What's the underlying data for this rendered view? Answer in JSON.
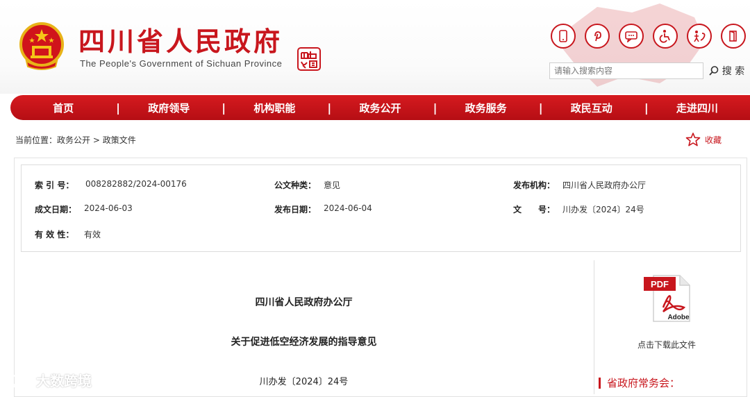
{
  "header": {
    "title": "四川省人民政府",
    "subtitle": "The People's Government of Sichuan Province",
    "emblem_icon": "national-emblem-icon",
    "seal_icon": "sichuan-seal-icon",
    "accent_color": "#c8161d",
    "icons": [
      "phone-icon",
      "pinterest-icon",
      "chat-icon",
      "accessibility-icon",
      "elder-care-icon",
      "exit-icon"
    ]
  },
  "search": {
    "placeholder": "请输入搜索内容",
    "button_label": "搜 索"
  },
  "nav": {
    "items": [
      "首页",
      "政府领导",
      "机构职能",
      "政务公开",
      "政务服务",
      "政民互动",
      "走进四川"
    ],
    "separator": "|"
  },
  "breadcrumb": {
    "prefix": "当前位置：",
    "items": [
      "政务公开",
      "政策文件"
    ],
    "separator": ">"
  },
  "favorite": {
    "label": "收藏"
  },
  "info": {
    "index_label": "索 引 号：",
    "index_value": "008282882/2024-00176",
    "type_label": "公文种类：",
    "type_value": "意见",
    "org_label": "发布机构：",
    "org_value": "四川省人民政府办公厅",
    "created_label": "成文日期：",
    "created_value": "2024-06-03",
    "published_label": "发布日期：",
    "published_value": "2024-06-04",
    "docno_label": "文　　号：",
    "docno_value": "川办发〔2024〕24号",
    "validity_label": "有 效 性：",
    "validity_value": "有效"
  },
  "article": {
    "issuer": "四川省人民政府办公厅",
    "title": "关于促进低空经济发展的指导意见",
    "doc_number": "川办发〔2024〕24号"
  },
  "sidebar": {
    "pdf_icon": "pdf-icon",
    "pdf_badge": "PDF",
    "pdf_brand": "Adobe",
    "download_label": "点击下载此文件",
    "section_title": "省政府常务会："
  },
  "watermark": {
    "text": "大数跨境"
  }
}
